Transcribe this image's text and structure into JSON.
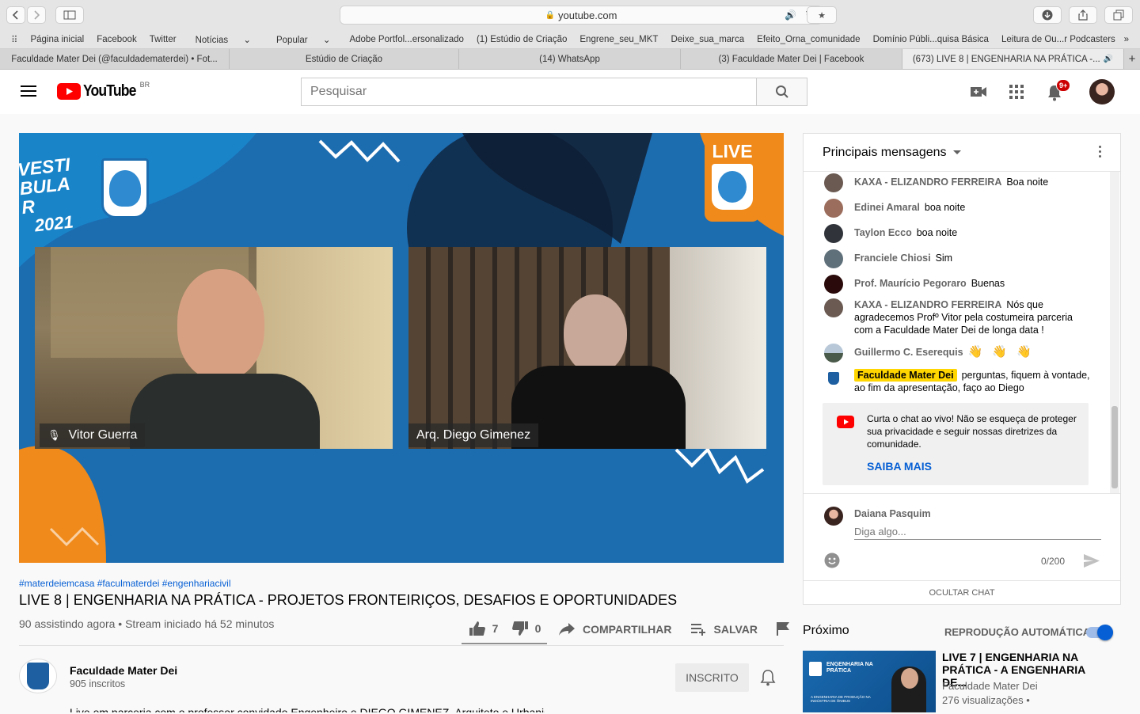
{
  "browser": {
    "url": "youtube.com",
    "bookmarks": [
      "Página inicial",
      "Facebook",
      "Twitter",
      "Notícias",
      "Popular",
      "Adobe Portfol...ersonalizado",
      "(1) Estúdio de Criação",
      "Engrene_seu_MKT",
      "Deixe_sua_marca",
      "Efeito_Orna_comunidade",
      "Domínio Públi...quisa Básica",
      "Leitura de Ou...r Podcasters"
    ],
    "tabs": [
      "Faculdade Mater Dei (@faculdadematerdei) • Fot...",
      "Estúdio de Criação",
      "(14) WhatsApp",
      "(3) Faculdade Mater Dei | Facebook",
      "(673) LIVE 8 | ENGENHARIA NA PRÁTICA -..."
    ]
  },
  "header": {
    "logo_text": "YouTube",
    "country": "BR",
    "search_placeholder": "Pesquisar",
    "notifications_badge": "9+"
  },
  "video": {
    "overlay_vestibular": "VESTIBULAR",
    "overlay_year": "2021",
    "overlay_live": "LIVE",
    "participant_1": "Vitor Guerra",
    "participant_2": "Arq. Diego Gimenez"
  },
  "info": {
    "tags": "#materdeiemcasa #faculmaterdei #engenhariacivil",
    "title": "LIVE 8 | ENGENHARIA NA PRÁTICA - PROJETOS FRONTEIRIÇOS, DESAFIOS E OPORTUNIDADES",
    "meta": "90 assistindo agora • Stream iniciado há 52 minutos",
    "likes": "7",
    "dislikes": "0",
    "share": "COMPARTILHAR",
    "save": "SALVAR",
    "channel_name": "Faculdade Mater Dei",
    "subscribers": "905 inscritos",
    "subscribed_label": "INSCRITO",
    "description_partial": "Live em parceria com o professor convidado Engenheiro e DIEGO GIMENEZ, Arquiteto e Urbanista..."
  },
  "chat": {
    "header": "Principais mensagens",
    "messages": [
      {
        "author": "KAXA - ELIZANDRO FERREIRA",
        "text": "Boa noite"
      },
      {
        "author": "Edinei Amaral",
        "text": "boa noite"
      },
      {
        "author": "Taylon Ecco",
        "text": "boa noite"
      },
      {
        "author": "Franciele Chiosi",
        "text": "Sim"
      },
      {
        "author": "Prof. Maurício Pegoraro",
        "text": "Buenas"
      },
      {
        "author": "KAXA - ELIZANDRO FERREIRA",
        "text": "Nós que agradecemos Profº Vitor pela costumeira parceria com a Faculdade Mater Dei de longa data !"
      },
      {
        "author": "Guillermo C. Eserequis",
        "text": "👋 👋 👋"
      },
      {
        "author": "Faculdade Mater Dei",
        "text": "perguntas, fiquem à vontade, ao fim da apresentação, faço ao Diego"
      }
    ],
    "notice_text": "Curta o chat ao vivo! Não se esqueça de proteger sua privacidade e seguir nossas diretrizes da comunidade.",
    "notice_link": "SAIBA MAIS",
    "current_user": "Daiana Pasquim",
    "input_placeholder": "Diga algo...",
    "char_count": "0/200",
    "hide_chat": "OCULTAR CHAT"
  },
  "next": {
    "label": "Próximo",
    "autoplay_label": "REPRODUÇÃO AUTOMÁTICA",
    "title": "LIVE 7 | ENGENHARIA NA PRÁTICA - A ENGENHARIA DE...",
    "channel": "Faculdade Mater Dei",
    "views": "276 visualizações •",
    "thumb_title": "ENGENHARIA NA PRÁTICA",
    "thumb_sub": "A ENGENHARIA DE PRODUÇÃO NA INDÚSTRIA DE ÔNIBUS"
  },
  "colors": {
    "accent": "#065fd4",
    "youtube_red": "#ff0000",
    "highlight": "#ffd600"
  }
}
